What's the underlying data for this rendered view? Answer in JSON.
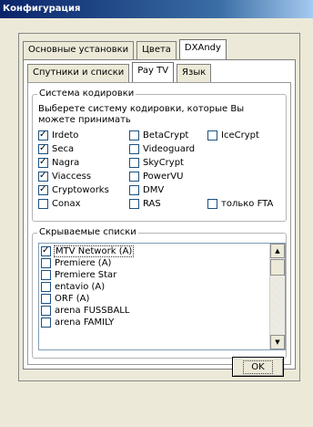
{
  "window": {
    "title": "Конфигурация"
  },
  "outer_tabs": [
    {
      "label": "Основные установки",
      "active": false
    },
    {
      "label": "Цвета",
      "active": false
    },
    {
      "label": "DXAndy",
      "active": true
    }
  ],
  "inner_tabs": [
    {
      "label": "Спутники и списки",
      "active": false
    },
    {
      "label": "Pay TV",
      "active": true
    },
    {
      "label": "Язык",
      "active": false
    }
  ],
  "encoding_group": {
    "title": "Система кодировки",
    "description": "Выберете систему кодировки, которые Вы можете принимать",
    "checkboxes": [
      {
        "label": "Irdeto",
        "checked": true
      },
      {
        "label": "Seca",
        "checked": true
      },
      {
        "label": "Nagra",
        "checked": true
      },
      {
        "label": "Viaccess",
        "checked": true
      },
      {
        "label": "Cryptoworks",
        "checked": true
      },
      {
        "label": "Conax",
        "checked": false
      },
      {
        "label": "BetaCrypt",
        "checked": false
      },
      {
        "label": "Videoguard",
        "checked": false
      },
      {
        "label": "SkyCrypt",
        "checked": false
      },
      {
        "label": "PowerVU",
        "checked": false
      },
      {
        "label": "DMV",
        "checked": false
      },
      {
        "label": "RAS",
        "checked": false
      },
      {
        "label": "IceCrypt",
        "checked": false
      },
      {
        "label": "только FTA",
        "checked": false
      }
    ]
  },
  "hidden_lists_group": {
    "title": "Скрываемые списки",
    "items": [
      {
        "label": "MTV Network (A)",
        "checked": true
      },
      {
        "label": "Premiere (A)",
        "checked": false
      },
      {
        "label": "Premiere Star",
        "checked": false
      },
      {
        "label": "entavio (A)",
        "checked": false
      },
      {
        "label": "ORF (A)",
        "checked": false
      },
      {
        "label": "arena FUSSBALL",
        "checked": false
      },
      {
        "label": "arena FAMILY",
        "checked": false
      }
    ]
  },
  "buttons": {
    "ok_label": "OK"
  }
}
